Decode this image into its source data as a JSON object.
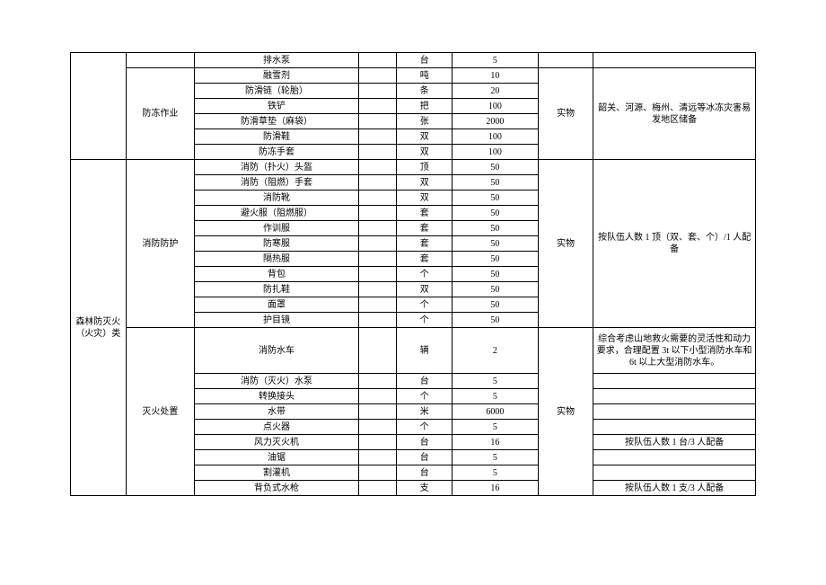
{
  "chart_data": {
    "type": "table",
    "title": "",
    "rows": [
      {
        "cat1": "",
        "cat2": "",
        "item": "排水泵",
        "spec": "",
        "unit": "台",
        "qty": "5",
        "form": "",
        "note": ""
      },
      {
        "cat1": "",
        "cat2": "防冻作业",
        "item": "融雪剂",
        "spec": "",
        "unit": "吨",
        "qty": "10",
        "form": "实物",
        "note": "韶关、河源、梅州、清远等冰冻灾害易发地区储备"
      },
      {
        "cat1": "",
        "cat2": "",
        "item": "防滑链（轮胎）",
        "spec": "",
        "unit": "条",
        "qty": "20",
        "form": "",
        "note": ""
      },
      {
        "cat1": "",
        "cat2": "",
        "item": "铁铲",
        "spec": "",
        "unit": "把",
        "qty": "100",
        "form": "",
        "note": ""
      },
      {
        "cat1": "",
        "cat2": "",
        "item": "防滑草垫（麻袋）",
        "spec": "",
        "unit": "张",
        "qty": "2000",
        "form": "",
        "note": ""
      },
      {
        "cat1": "",
        "cat2": "",
        "item": "防滑鞋",
        "spec": "",
        "unit": "双",
        "qty": "100",
        "form": "",
        "note": ""
      },
      {
        "cat1": "",
        "cat2": "",
        "item": "防冻手套",
        "spec": "",
        "unit": "双",
        "qty": "100",
        "form": "",
        "note": ""
      },
      {
        "cat1": "森林防灭火（火灾）类",
        "cat2": "消防防护",
        "item": "消防（扑火）头盔",
        "spec": "",
        "unit": "顶",
        "qty": "50",
        "form": "实物",
        "note": "按队伍人数 1 顶（双、套、个）/1 人配备"
      },
      {
        "cat1": "",
        "cat2": "",
        "item": "消防（阻燃）手套",
        "spec": "",
        "unit": "双",
        "qty": "50",
        "form": "",
        "note": ""
      },
      {
        "cat1": "",
        "cat2": "",
        "item": "消防靴",
        "spec": "",
        "unit": "双",
        "qty": "50",
        "form": "",
        "note": ""
      },
      {
        "cat1": "",
        "cat2": "",
        "item": "避火服（阻燃服）",
        "spec": "",
        "unit": "套",
        "qty": "50",
        "form": "",
        "note": ""
      },
      {
        "cat1": "",
        "cat2": "",
        "item": "作训服",
        "spec": "",
        "unit": "套",
        "qty": "50",
        "form": "",
        "note": ""
      },
      {
        "cat1": "",
        "cat2": "",
        "item": "防寒服",
        "spec": "",
        "unit": "套",
        "qty": "50",
        "form": "",
        "note": ""
      },
      {
        "cat1": "",
        "cat2": "",
        "item": "隔热服",
        "spec": "",
        "unit": "套",
        "qty": "50",
        "form": "",
        "note": ""
      },
      {
        "cat1": "",
        "cat2": "",
        "item": "背包",
        "spec": "",
        "unit": "个",
        "qty": "50",
        "form": "",
        "note": ""
      },
      {
        "cat1": "",
        "cat2": "",
        "item": "防扎鞋",
        "spec": "",
        "unit": "双",
        "qty": "50",
        "form": "",
        "note": ""
      },
      {
        "cat1": "",
        "cat2": "",
        "item": "面罩",
        "spec": "",
        "unit": "个",
        "qty": "50",
        "form": "",
        "note": ""
      },
      {
        "cat1": "",
        "cat2": "",
        "item": "护目镜",
        "spec": "",
        "unit": "个",
        "qty": "50",
        "form": "",
        "note": ""
      },
      {
        "cat1": "",
        "cat2": "灭火处置",
        "item": "消防水车",
        "spec": "",
        "unit": "辆",
        "qty": "2",
        "form": "实物",
        "note": "综合考虑山地救火需要的灵活性和动力要求，合理配置 3t 以下小型消防水车和 6t 以上大型消防水车。"
      },
      {
        "cat1": "",
        "cat2": "",
        "item": "消防（灭火）水泵",
        "spec": "",
        "unit": "台",
        "qty": "5",
        "form": "",
        "note": ""
      },
      {
        "cat1": "",
        "cat2": "",
        "item": "转换接头",
        "spec": "",
        "unit": "个",
        "qty": "5",
        "form": "",
        "note": ""
      },
      {
        "cat1": "",
        "cat2": "",
        "item": "水带",
        "spec": "",
        "unit": "米",
        "qty": "6000",
        "form": "",
        "note": ""
      },
      {
        "cat1": "",
        "cat2": "",
        "item": "点火器",
        "spec": "",
        "unit": "个",
        "qty": "5",
        "form": "",
        "note": ""
      },
      {
        "cat1": "",
        "cat2": "",
        "item": "风力灭火机",
        "spec": "",
        "unit": "台",
        "qty": "16",
        "form": "",
        "note": "按队伍人数 1 台/3 人配备"
      },
      {
        "cat1": "",
        "cat2": "",
        "item": "油锯",
        "spec": "",
        "unit": "台",
        "qty": "5",
        "form": "",
        "note": ""
      },
      {
        "cat1": "",
        "cat2": "",
        "item": "割灌机",
        "spec": "",
        "unit": "台",
        "qty": "5",
        "form": "",
        "note": ""
      },
      {
        "cat1": "",
        "cat2": "",
        "item": "背负式水枪",
        "spec": "",
        "unit": "支",
        "qty": "16",
        "form": "",
        "note": "按队伍人数 1 支/3 人配备"
      }
    ]
  },
  "r0": {
    "item": "排水泵",
    "unit": "台",
    "qty": "5"
  },
  "r1": {
    "item": "融雪剂",
    "unit": "吨",
    "qty": "10"
  },
  "r2": {
    "item": "防滑链（轮胎）",
    "unit": "条",
    "qty": "20"
  },
  "r3": {
    "item": "铁铲",
    "unit": "把",
    "qty": "100"
  },
  "r4": {
    "item": "防滑草垫（麻袋）",
    "unit": "张",
    "qty": "2000"
  },
  "r5": {
    "item": "防滑鞋",
    "unit": "双",
    "qty": "100"
  },
  "r6": {
    "item": "防冻手套",
    "unit": "双",
    "qty": "100"
  },
  "r7": {
    "item": "消防（扑火）头盔",
    "unit": "顶",
    "qty": "50"
  },
  "r8": {
    "item": "消防（阻燃）手套",
    "unit": "双",
    "qty": "50"
  },
  "r9": {
    "item": "消防靴",
    "unit": "双",
    "qty": "50"
  },
  "r10": {
    "item": "避火服（阻燃服）",
    "unit": "套",
    "qty": "50"
  },
  "r11": {
    "item": "作训服",
    "unit": "套",
    "qty": "50"
  },
  "r12": {
    "item": "防寒服",
    "unit": "套",
    "qty": "50"
  },
  "r13": {
    "item": "隔热服",
    "unit": "套",
    "qty": "50"
  },
  "r14": {
    "item": "背包",
    "unit": "个",
    "qty": "50"
  },
  "r15": {
    "item": "防扎鞋",
    "unit": "双",
    "qty": "50"
  },
  "r16": {
    "item": "面罩",
    "unit": "个",
    "qty": "50"
  },
  "r17": {
    "item": "护目镜",
    "unit": "个",
    "qty": "50"
  },
  "r18": {
    "item": "消防水车",
    "unit": "辆",
    "qty": "2"
  },
  "r19": {
    "item": "消防（灭火）水泵",
    "unit": "台",
    "qty": "5"
  },
  "r20": {
    "item": "转换接头",
    "unit": "个",
    "qty": "5"
  },
  "r21": {
    "item": "水带",
    "unit": "米",
    "qty": "6000"
  },
  "r22": {
    "item": "点火器",
    "unit": "个",
    "qty": "5"
  },
  "r23": {
    "item": "风力灭火机",
    "unit": "台",
    "qty": "16"
  },
  "r24": {
    "item": "油锯",
    "unit": "台",
    "qty": "5"
  },
  "r25": {
    "item": "割灌机",
    "unit": "台",
    "qty": "5"
  },
  "r26": {
    "item": "背负式水枪",
    "unit": "支",
    "qty": "16"
  },
  "cat": {
    "freeze": "防冻作业",
    "forest": "森林防灭火（火灾）类",
    "protect": "消防防护",
    "fire": "灭火处置"
  },
  "form": {
    "wu": "实物"
  },
  "note": {
    "freeze": "韶关、河源、梅州、清远等冰冻灾害易发地区储备",
    "protect": "按队伍人数 1 顶（双、套、个）/1 人配备",
    "truck": "综合考虑山地救火需要的灵活性和动力要求，合理配置 3t 以下小型消防水车和 6t 以上大型消防水车。",
    "wind": "按队伍人数 1 台/3 人配备",
    "gun": "按队伍人数 1 支/3 人配备"
  }
}
